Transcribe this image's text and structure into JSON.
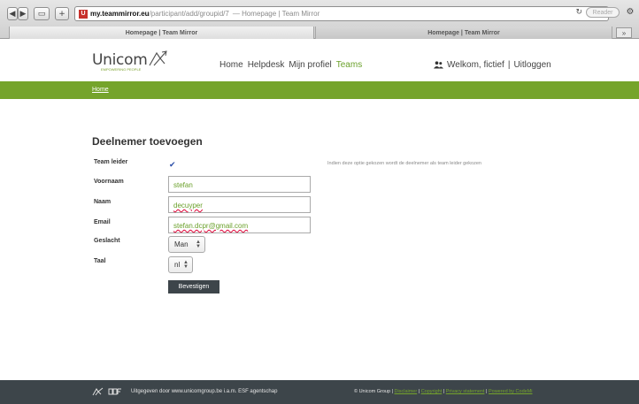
{
  "browser": {
    "url_host": "my.teammirror.eu",
    "url_path": "/participant/add/groupid/7",
    "url_title": "— Homepage | Team Mirror",
    "reader_label": "Reader",
    "tabs": [
      {
        "label": "Homepage | Team Mirror"
      },
      {
        "label": "Homepage | Team Mirror"
      }
    ]
  },
  "header": {
    "logo_text": "Unicom",
    "logo_tagline": "EMPOWERING PEOPLE",
    "nav": [
      {
        "label": "Home"
      },
      {
        "label": "Helpdesk"
      },
      {
        "label": "Mijn profiel"
      },
      {
        "label": "Teams",
        "active": true
      }
    ],
    "welcome": "Welkom, fictief",
    "separator": "|",
    "logout": "Uitloggen"
  },
  "breadcrumb": {
    "home": "Home"
  },
  "form": {
    "title": "Deelnemer toevoegen",
    "team_leader_label": "Team leider",
    "team_leader_checked": true,
    "team_leader_hint": "Indien deze optie gekozen wordt de deelnemer als team leider gekozen",
    "firstname_label": "Voornaam",
    "firstname_value": "stefan",
    "lastname_label": "Naam",
    "lastname_value": "decuyper",
    "email_label": "Email",
    "email_value": "stefan.dcpr@gmail.com",
    "gender_label": "Geslacht",
    "gender_value": "Man",
    "language_label": "Taal",
    "language_value": "nl",
    "submit_label": "Bevestigen"
  },
  "footer": {
    "published_by": "Uitgegeven door www.unicomgroup.be i.a.m. ESF agentschap",
    "copyright": "© Unicom Group |",
    "links": [
      "Disclaimer",
      "Copyright",
      "Privacy statement",
      "Powered by CodeMi"
    ]
  },
  "colors": {
    "brand_green": "#75a42b",
    "footer_dark": "#3d454a",
    "button_dark": "#3d454a"
  }
}
